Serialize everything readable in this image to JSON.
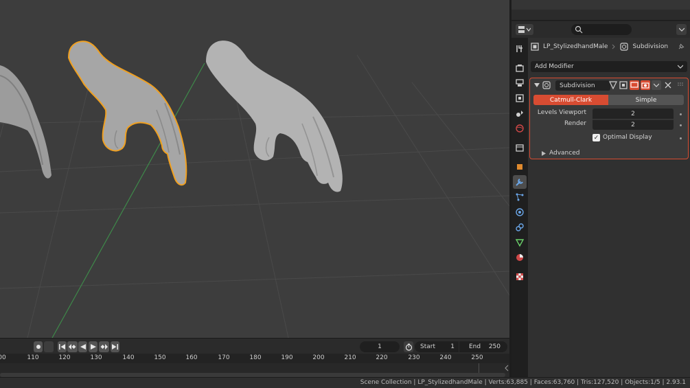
{
  "properties": {
    "context": {
      "object_name": "LP_StylizedhandMale",
      "modifier_name": "Subdivision"
    },
    "add_modifier_label": "Add Modifier",
    "tabs": [
      "tool-icon",
      "render-icon",
      "output-icon",
      "view-layer-icon",
      "scene-icon",
      "world-icon",
      "collection-icon",
      "object-icon",
      "modifier-icon",
      "particles-icon",
      "physics-icon",
      "constraints-icon",
      "data-icon",
      "material-icon",
      "texture-icon"
    ],
    "active_tab": "modifier-icon",
    "modifier": {
      "name": "Subdivision",
      "type_options": [
        "Catmull-Clark",
        "Simple"
      ],
      "selected_type": "Catmull-Clark",
      "levels_viewport_label": "Levels Viewport",
      "levels_viewport_value": "2",
      "render_label": "Render",
      "render_value": "2",
      "optimal_display_label": "Optimal Display",
      "optimal_display_checked": true,
      "advanced_label": "Advanced"
    },
    "accent_color": "#d84c32"
  },
  "timeline": {
    "current_frame": "1",
    "start_label": "Start",
    "start_value": "1",
    "end_label": "End",
    "end_value": "250",
    "ruler_ticks": [
      "00",
      "110",
      "120",
      "130",
      "140",
      "150",
      "160",
      "170",
      "180",
      "190",
      "200",
      "210",
      "220",
      "230",
      "240",
      "250"
    ]
  },
  "status_bar": {
    "text": "Scene Collection | LP_StylizedhandMale | Verts:63,885 | Faces:63,760 | Tris:127,520 | Objects:1/5 | 2.93.1"
  }
}
